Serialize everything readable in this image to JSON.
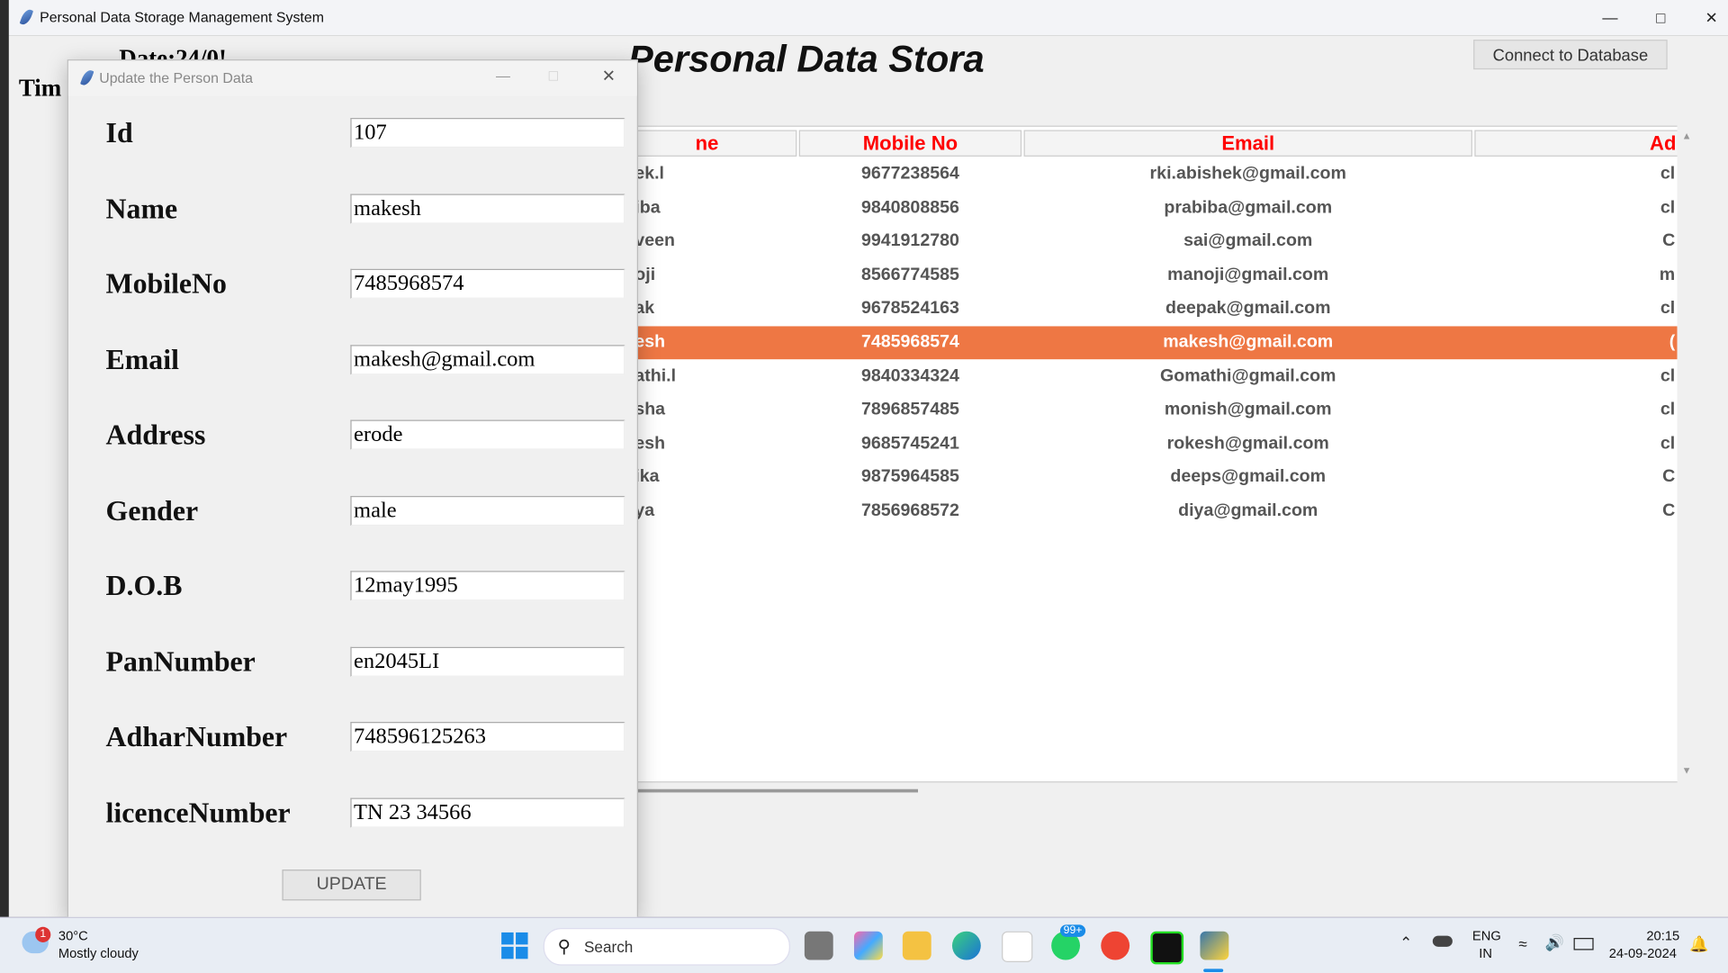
{
  "window": {
    "title": "Personal Data Storage Management System"
  },
  "main": {
    "date_label": "Date:24/0!",
    "time_label": "Tim",
    "heading": "Personal Data Stora",
    "connect_button": "Connect to Database"
  },
  "table": {
    "headers": [
      "ne",
      "Mobile No",
      "Email",
      "Ad"
    ],
    "selected_index": 5,
    "rows": [
      [
        "ek.l",
        "9677238564",
        "rki.abishek@gmail.com",
        "cl"
      ],
      [
        "iba",
        "9840808856",
        "prabiba@gmail.com",
        "cl"
      ],
      [
        "veen",
        "9941912780",
        "sai@gmail.com",
        "C"
      ],
      [
        "oji",
        "8566774585",
        "manoji@gmail.com",
        "m"
      ],
      [
        "ak",
        "9678524163",
        "deepak@gmail.com",
        "cl"
      ],
      [
        "esh",
        "7485968574",
        "makesh@gmail.com",
        "("
      ],
      [
        "athi.l",
        "9840334324",
        "Gomathi@gmail.com",
        "cl"
      ],
      [
        "sha",
        "7896857485",
        "monish@gmail.com",
        "cl"
      ],
      [
        "esh",
        "9685745241",
        "rokesh@gmail.com",
        "cl"
      ],
      [
        "ika",
        "9875964585",
        "deeps@gmail.com",
        "C"
      ],
      [
        "ya",
        "7856968572",
        "diya@gmail.com",
        "C"
      ]
    ]
  },
  "dialog": {
    "title": "Update the Person Data",
    "fields": [
      {
        "label": "Id",
        "value": "107"
      },
      {
        "label": "Name",
        "value": "makesh"
      },
      {
        "label": "MobileNo",
        "value": "7485968574"
      },
      {
        "label": "Email",
        "value": "makesh@gmail.com"
      },
      {
        "label": "Address",
        "value": "erode"
      },
      {
        "label": "Gender",
        "value": "male"
      },
      {
        "label": "D.O.B",
        "value": "12may1995"
      },
      {
        "label": "PanNumber",
        "value": "en2045LI"
      },
      {
        "label": "AdharNumber",
        "value": "748596125263"
      },
      {
        "label": "licenceNumber",
        "value": "TN 23 34566"
      }
    ],
    "update_button": "UPDATE"
  },
  "taskbar": {
    "weather_temp": "30°C",
    "weather_desc": "Mostly cloudy",
    "weather_badge": "1",
    "search": "Search",
    "whatsapp_badge": "99+",
    "lang1": "ENG",
    "lang2": "IN",
    "time": "20:15",
    "date": "24-09-2024"
  },
  "colors": {
    "selected_row": "#ee7744",
    "header_text": "#ff0000"
  }
}
